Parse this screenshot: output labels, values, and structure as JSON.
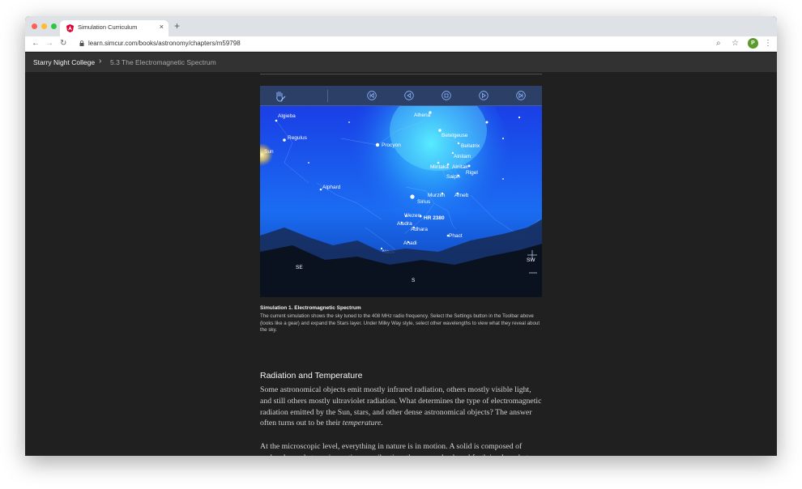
{
  "browser": {
    "tab_title": "Simulation Curriculum",
    "new_tab": "+",
    "close_tab": "×",
    "url": "learn.simcur.com/books/astronomy/chapters/m59798",
    "profile_initial": "P",
    "back_icon": "←",
    "forward_icon": "→",
    "reload_icon": "↻",
    "search_icon": "⌕",
    "star_icon": "☆",
    "menu_icon": "⋮"
  },
  "site": {
    "brand": "Starry Night College",
    "separator": "›",
    "breadcrumb": "5.3 The Electromagnetic Spectrum"
  },
  "simulation": {
    "stars": [
      {
        "label": "Algieba"
      },
      {
        "label": "Alhena"
      },
      {
        "label": "Regulus"
      },
      {
        "label": "Betelgeuse"
      },
      {
        "label": "Procyon"
      },
      {
        "label": "Bellatrix"
      },
      {
        "label": "Sun"
      },
      {
        "label": "Alnilam"
      },
      {
        "label": "Mintaka"
      },
      {
        "label": "Alnitak"
      },
      {
        "label": "Rigel"
      },
      {
        "label": "Saiph"
      },
      {
        "label": "Alphard"
      },
      {
        "label": "Murzim"
      },
      {
        "label": "Arneb"
      },
      {
        "label": "Sirius"
      },
      {
        "label": "Wezen"
      },
      {
        "label": "HR 2380"
      },
      {
        "label": "Aludra"
      },
      {
        "label": "Adhara"
      },
      {
        "label": "Phact"
      },
      {
        "label": "Ahadi"
      },
      {
        "label": "Naos"
      }
    ],
    "compass": [
      "SE",
      "S",
      "SW"
    ],
    "colors": {
      "accent": "#3d7bff",
      "sky_top": "#1a4cf0",
      "sky_glow": "#2ee0ff",
      "ground": "#0a1220"
    }
  },
  "caption": {
    "title": "Simulation 1. Electromagnetic Spectrum",
    "text": "The current simulation shows the sky tuned to the 408 MHz radio frequency. Select the Settings button in the Toolbar above (looks like a gear) and expand the Stars layer. Under Milky Way style, select other wavelengths to view what they reveal about the sky."
  },
  "article": {
    "heading": "Radiation and Temperature",
    "p1_before": "Some astronomical objects emit mostly infrared radiation, others mostly visible light, and still others mostly ultraviolet radiation. What determines the type of electromagnetic radiation emitted by the Sun, stars, and other dense astronomical objects? The answer often turns out to be their ",
    "p1_em": "temperature",
    "p1_after": ".",
    "p2": "At the microscopic level, everything in nature is in motion. A solid is composed of molecules and atoms in continuous vibration: they move back and forth in place, but their motion is much too small for our eyes to make out. A gas"
  }
}
